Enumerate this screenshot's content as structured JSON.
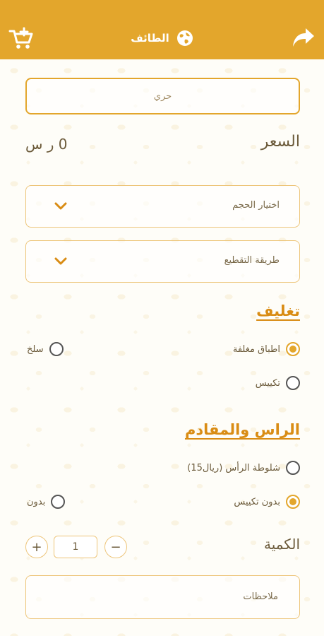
{
  "header": {
    "title": "الطائف",
    "cart_icon": "cart-plus-icon",
    "globe_icon": "globe-icon",
    "share_icon": "share-icon",
    "accent": "#e3a62c"
  },
  "product": {
    "name": "حري"
  },
  "price": {
    "label": "السعر",
    "value": "0 ر س"
  },
  "size_dropdown": {
    "placeholder": "اختيار الحجم"
  },
  "cut_dropdown": {
    "placeholder": "طريقة التقطيع"
  },
  "packaging": {
    "title": "تغليف",
    "options": [
      {
        "label": "اطباق مغلفة",
        "selected": true
      },
      {
        "label": "سلخ",
        "selected": false
      },
      {
        "label": "تكييس",
        "selected": false
      }
    ]
  },
  "head_section": {
    "title": "الراس والمقادم",
    "options": [
      {
        "label": "شلوطة الرأس (ريال15)",
        "selected": false
      },
      {
        "label": "بدون تكييس",
        "selected": true
      },
      {
        "label": "بدون",
        "selected": false
      }
    ]
  },
  "quantity": {
    "label": "الكمية",
    "value": "1",
    "plus": "+",
    "minus": "−"
  },
  "notes": {
    "placeholder": "ملاحظات"
  }
}
